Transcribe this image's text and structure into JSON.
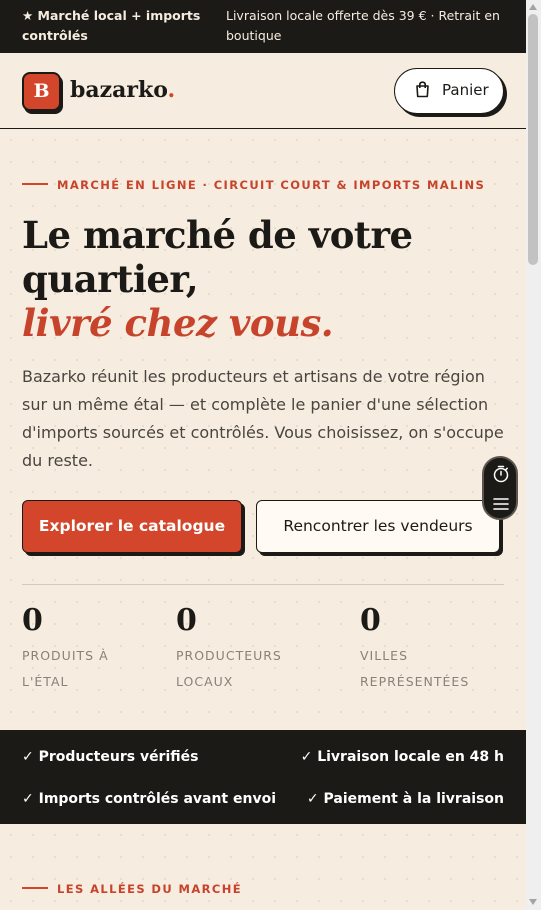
{
  "topbar": {
    "left_text": "★ Marché local + imports contrôlés",
    "right_text": "Livraison locale offerte dès 39 € · Retrait en boutique"
  },
  "header": {
    "logo_letter": "B",
    "brand_name": "bazarko",
    "brand_dot": ".",
    "cart_label": "Panier",
    "cart_icon": "shopping-bag-icon"
  },
  "hero": {
    "eyebrow": "MARCHÉ EN LIGNE · CIRCUIT COURT & IMPORTS MALINS",
    "title_line1": "Le marché de votre",
    "title_line2": "quartier,",
    "title_accent": "livré chez vous.",
    "lead": "Bazarko réunit les producteurs et artisans de votre région sur un même étal — et complète le panier d'une sélection d'imports sourcés et contrôlés. Vous choisissez, on s'occupe du reste.",
    "primary_button": "Explorer le catalogue",
    "secondary_button": "Rencontrer les vendeurs"
  },
  "stats": [
    {
      "value": "0",
      "label_1": "PRODUITS À",
      "label_2": "L'ÉTAL"
    },
    {
      "value": "0",
      "label_1": "PRODUCTEURS",
      "label_2": "LOCAUX"
    },
    {
      "value": "0",
      "label_1": "VILLES",
      "label_2": "REPRÉSENTÉES"
    }
  ],
  "floating_tools": {
    "icons": [
      "timer-icon",
      "menu-icon"
    ]
  },
  "trust": {
    "items": [
      "✓ Producteurs vérifiés",
      "✓ Livraison locale en 48 h",
      "✓ Imports contrôlés avant envoi",
      "✓ Paiement à la livraison"
    ]
  },
  "section2": {
    "eyebrow": "LES ALLÉES DU MARCHÉ"
  },
  "colors": {
    "accent": "#d3462b",
    "dark": "#1c1a17",
    "background": "#f6ede0"
  }
}
